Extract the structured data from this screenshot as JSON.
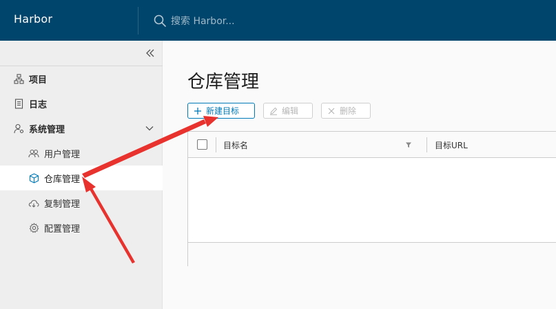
{
  "header": {
    "app_title": "Harbor",
    "search_placeholder": "搜索 Harbor..."
  },
  "sidebar": {
    "collapse_icon": "double-chevron-left-icon",
    "items": [
      {
        "label": "项目",
        "icon": "projects-icon",
        "level": "top"
      },
      {
        "label": "日志",
        "icon": "logs-icon",
        "level": "top"
      },
      {
        "label": "系统管理",
        "icon": "admin-icon",
        "level": "top",
        "expanded": true
      },
      {
        "label": "用户管理",
        "icon": "users-icon",
        "level": "sub"
      },
      {
        "label": "仓库管理",
        "icon": "registry-box-icon",
        "level": "sub",
        "active": true
      },
      {
        "label": "复制管理",
        "icon": "replication-cloud-icon",
        "level": "sub"
      },
      {
        "label": "配置管理",
        "icon": "config-gear-icon",
        "level": "sub"
      }
    ]
  },
  "main": {
    "page_title": "仓库管理",
    "toolbar": {
      "new_label": "新建目标",
      "edit_label": "编辑",
      "delete_label": "删除"
    },
    "table": {
      "columns": [
        "目标名",
        "目标URL"
      ],
      "rows": []
    }
  },
  "colors": {
    "header_bg": "#00456c",
    "accent": "#0079b8",
    "annotation_arrow": "#e8322e"
  }
}
